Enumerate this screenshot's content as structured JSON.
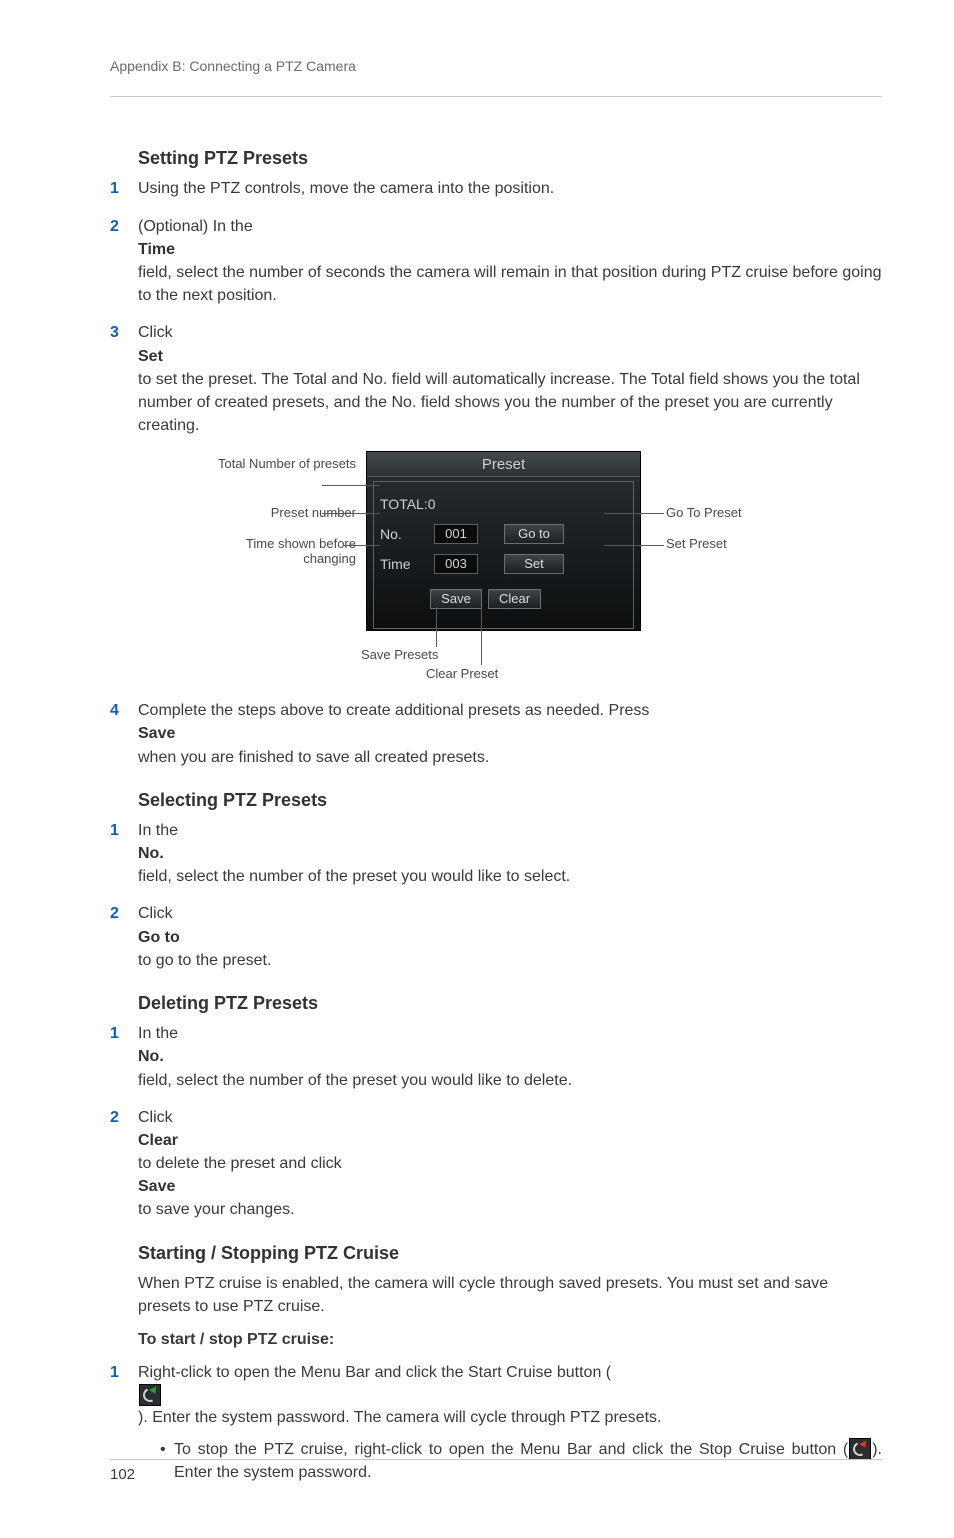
{
  "header": {
    "breadcrumb": "Appendix B: Connecting a PTZ Camera"
  },
  "page_number": "102",
  "sections": {
    "setting": {
      "heading": "Setting PTZ Presets",
      "steps": {
        "1": "Using the PTZ controls, move the camera into the position.",
        "2a": "(Optional) In the ",
        "2b": "Time",
        "2c": " field, select the number of seconds the camera will remain in that position during PTZ cruise before going to the next position.",
        "3a": "Click ",
        "3b": "Set",
        "3c": " to set the preset. The Total and No. field will automatically increase. The Total field shows you the total number of created presets, and the No. field shows you the number of the preset you are currently creating.",
        "4a": "Complete the steps above to create additional presets as needed. Press ",
        "4b": "Save",
        "4c": " when you are finished to save all created presets."
      }
    },
    "selecting": {
      "heading": "Selecting PTZ Presets",
      "steps": {
        "1a": "In the ",
        "1b": "No.",
        "1c": " field, select the number of the preset you would like to select.",
        "2a": "Click ",
        "2b": "Go to",
        "2c": " to go to the preset."
      }
    },
    "deleting": {
      "heading": "Deleting PTZ Presets",
      "steps": {
        "1a": "In the ",
        "1b": "No.",
        "1c": " field, select the number of the preset you would like to delete.",
        "2a": "Click ",
        "2b": "Clear",
        "2c": " to delete the preset and click ",
        "2d": "Save",
        "2e": " to save your changes."
      }
    },
    "cruise": {
      "heading": "Starting / Stopping PTZ Cruise",
      "intro": "When PTZ cruise is enabled, the camera will cycle through saved presets. You must set and save presets to use PTZ cruise.",
      "subhead": "To start / stop PTZ cruise:",
      "step1a": "Right-click to open the Menu Bar and click the Start Cruise button (",
      "step1b": "). Enter the system password. The camera will cycle through PTZ presets.",
      "bullet_a": "To stop the PTZ cruise, right-click to open the Menu Bar and click the Stop Cruise button (",
      "bullet_b": "). Enter the system password."
    }
  },
  "figure": {
    "panel_title": "Preset",
    "total_label": "TOTAL:0",
    "no_label": "No.",
    "no_value": "001",
    "time_label": "Time",
    "time_value": "003",
    "goto_btn": "Go to",
    "set_btn": "Set",
    "save_btn": "Save",
    "clear_btn": "Clear",
    "callouts": {
      "total": "Total Number of presets",
      "preset_no": "Preset number",
      "time": "Time shown before changing",
      "goto": "Go To Preset",
      "set": "Set Preset",
      "save": "Save Presets",
      "clear": "Clear Preset"
    }
  }
}
